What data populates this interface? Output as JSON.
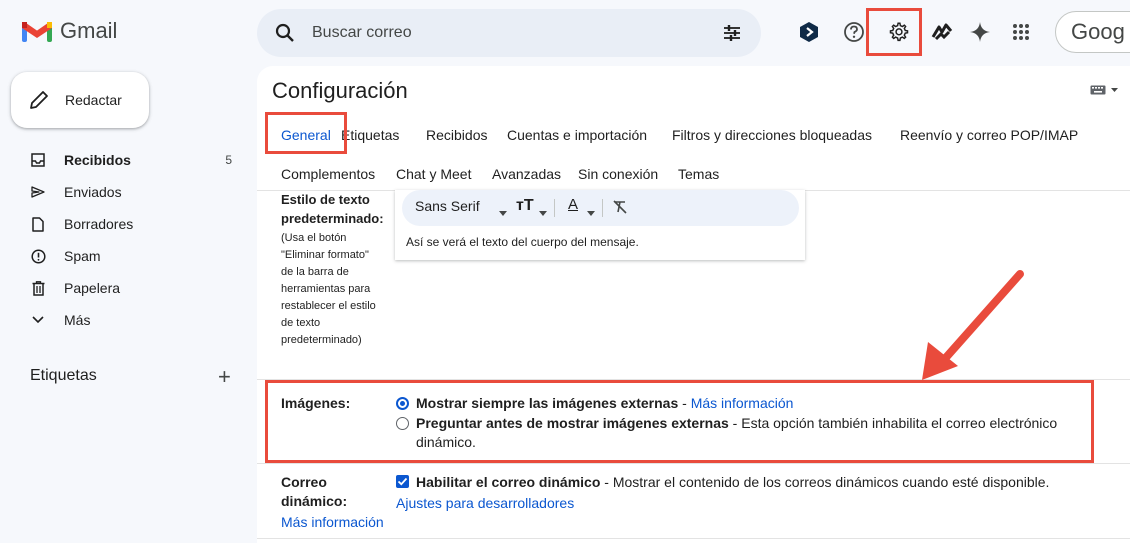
{
  "app": {
    "name": "Gmail"
  },
  "search": {
    "placeholder": "Buscar correo"
  },
  "brand_pill": "Goog",
  "compose": {
    "label": "Redactar"
  },
  "nav": [
    {
      "id": "inbox",
      "label": "Recibidos",
      "count": "5",
      "icon": "inbox-icon"
    },
    {
      "id": "sent",
      "label": "Enviados",
      "count": "",
      "icon": "send-icon"
    },
    {
      "id": "drafts",
      "label": "Borradores",
      "count": "",
      "icon": "draft-icon"
    },
    {
      "id": "spam",
      "label": "Spam",
      "count": "",
      "icon": "spam-icon"
    },
    {
      "id": "trash",
      "label": "Papelera",
      "count": "",
      "icon": "trash-icon"
    },
    {
      "id": "more",
      "label": "Más",
      "count": "",
      "icon": "chevron-down-icon"
    }
  ],
  "labels_heading": "Etiquetas",
  "settings": {
    "title": "Configuración",
    "tabs_row1": [
      "General",
      "Etiquetas",
      "Recibidos",
      "Cuentas e importación",
      "Filtros y direcciones bloqueadas",
      "Reenvío y correo POP/IMAP"
    ],
    "tabs_row2": [
      "Complementos",
      "Chat y Meet",
      "Avanzadas",
      "Sin conexión",
      "Temas"
    ],
    "active_tab": "General",
    "default_text": {
      "label_line1": "Estilo de texto",
      "label_line2": "predeterminado:",
      "help_lines": [
        "(Usa el botón",
        "\"Eliminar formato\"",
        "de la barra de",
        "herramientas para",
        "restablecer el estilo",
        "de texto",
        "predeterminado)"
      ],
      "font": "Sans Serif",
      "sample": "Así se verá el texto del cuerpo del mensaje."
    },
    "images": {
      "label": "Imágenes:",
      "option1_bold": "Mostrar siempre las imágenes externas",
      "option1_sep": " - ",
      "option1_link": "Más información",
      "option2_bold": "Preguntar antes de mostrar imágenes externas",
      "option2_rest": " - Esta opción también inhabilita el correo electrónico",
      "option2_rest2": "dinámico.",
      "selected": 1
    },
    "dynamic": {
      "label_line1": "Correo",
      "label_line2": "dinámico:",
      "label_link": "Más información",
      "checkbox_bold": "Habilitar el correo dinámico",
      "checkbox_rest": " - Mostrar el contenido de los correos dinámicos cuando esté disponible.",
      "dev_link": "Ajustes para desarrolladores",
      "checked": true
    }
  },
  "colors": {
    "accent": "#0b57d0",
    "annotation": "#e94b3c",
    "gmail_red": "#ea4335"
  }
}
